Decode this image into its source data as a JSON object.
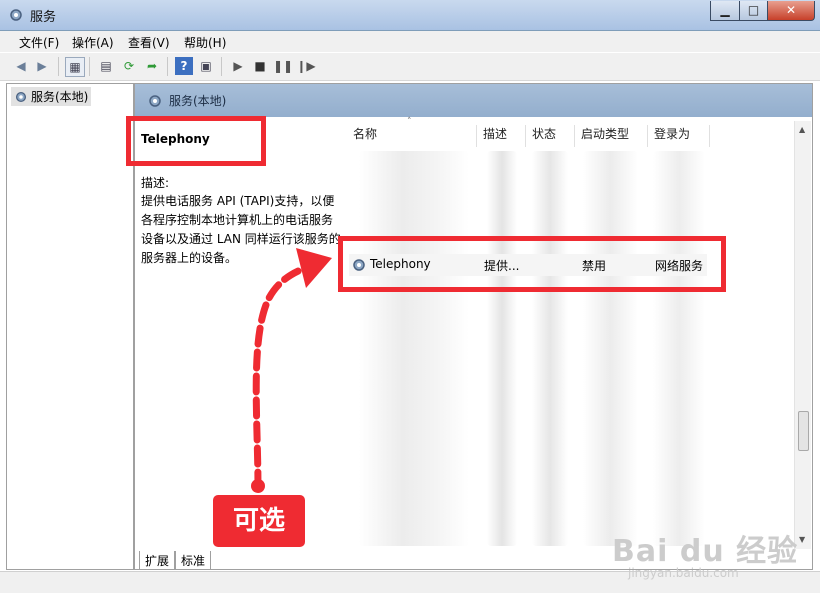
{
  "window": {
    "title": "服务",
    "controls": {
      "minimize": "▁",
      "maximize": "□",
      "close": "✕"
    }
  },
  "menu": [
    "文件(F)",
    "操作(A)",
    "查看(V)",
    "帮助(H)"
  ],
  "toolbar_icons": [
    "back-icon",
    "forward-icon",
    "console-tree-icon",
    "properties-icon",
    "refresh-icon",
    "export-icon",
    "help-icon",
    "mmc-view-icon",
    "play-icon",
    "stop-icon",
    "pause-icon",
    "resume-icon"
  ],
  "tree": {
    "root": "服务(本地)"
  },
  "panel": {
    "header": "服务(本地)"
  },
  "detail": {
    "name": "Telephony",
    "desc_label": "描述:",
    "desc_lines": [
      "提供电话服务 API (TAPI)支持，以便",
      "各程序控制本地计算机上的电话服务",
      "设备以及通过 LAN 同样运行该服务的",
      "服务器上的设备。"
    ]
  },
  "list": {
    "columns": [
      "名称",
      "描述",
      "状态",
      "启动类型",
      "登录为"
    ],
    "selected_row": {
      "name": "Telephony",
      "desc": "提供...",
      "status": "",
      "startup": "禁用",
      "logon": "网络服务"
    }
  },
  "tabs": [
    "扩展",
    "标准"
  ],
  "annotation": {
    "label": "可选",
    "accent": "#ef2b32"
  },
  "watermark": {
    "brand": "Bai du 经验",
    "url": "jingyan.baidu.com"
  }
}
